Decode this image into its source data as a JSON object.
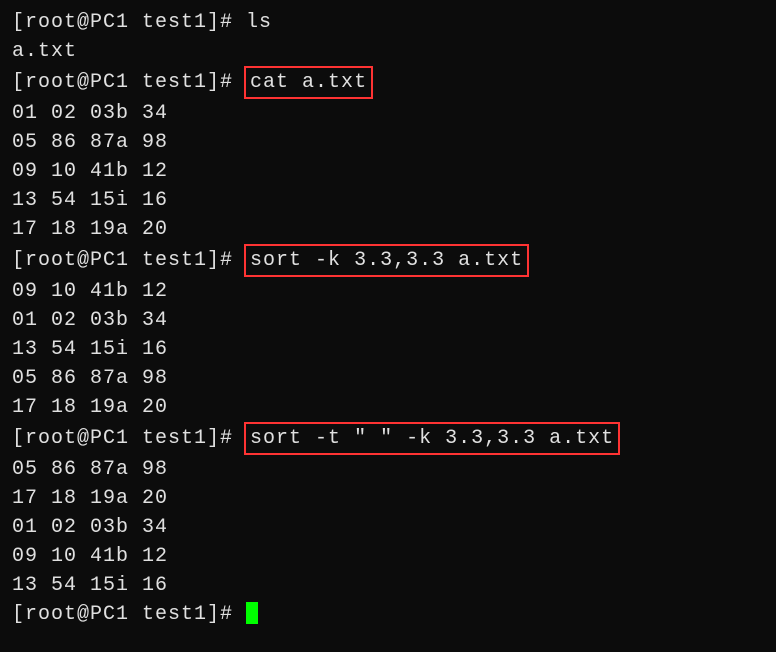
{
  "prompt": "[root@PC1 test1]# ",
  "lines": [
    {
      "type": "prompt",
      "cmd": "ls",
      "highlight": false
    },
    {
      "type": "output",
      "text": "a.txt"
    },
    {
      "type": "prompt",
      "cmd": "cat a.txt",
      "highlight": true
    },
    {
      "type": "output",
      "text": "01 02 03b 34"
    },
    {
      "type": "output",
      "text": "05 86 87a 98"
    },
    {
      "type": "output",
      "text": "09 10 41b 12"
    },
    {
      "type": "output",
      "text": "13 54 15i 16"
    },
    {
      "type": "output",
      "text": "17 18 19a 20"
    },
    {
      "type": "prompt",
      "cmd": "sort -k 3.3,3.3 a.txt",
      "highlight": true
    },
    {
      "type": "output",
      "text": "09 10 41b 12"
    },
    {
      "type": "output",
      "text": "01 02 03b 34"
    },
    {
      "type": "output",
      "text": "13 54 15i 16"
    },
    {
      "type": "output",
      "text": "05 86 87a 98"
    },
    {
      "type": "output",
      "text": "17 18 19a 20"
    },
    {
      "type": "prompt",
      "cmd": "sort -t \" \" -k 3.3,3.3 a.txt",
      "highlight": true
    },
    {
      "type": "output",
      "text": "05 86 87a 98"
    },
    {
      "type": "output",
      "text": "17 18 19a 20"
    },
    {
      "type": "output",
      "text": "01 02 03b 34"
    },
    {
      "type": "output",
      "text": "09 10 41b 12"
    },
    {
      "type": "output",
      "text": "13 54 15i 16"
    },
    {
      "type": "prompt",
      "cmd": "",
      "highlight": false,
      "cursor": true
    }
  ]
}
